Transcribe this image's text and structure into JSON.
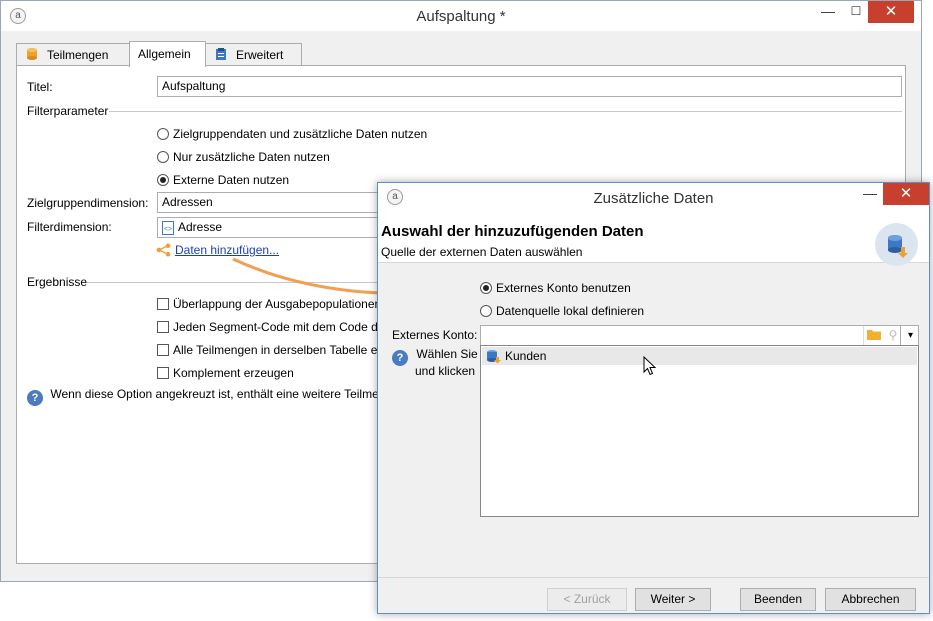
{
  "main_window": {
    "title": "Aufspaltung *",
    "controls": {
      "minimize": "—",
      "maximize": "☐",
      "close": "✕"
    },
    "tabs": [
      {
        "label": "Teilmengen",
        "icon": "database-icon"
      },
      {
        "label": "Allgemein",
        "icon": "none"
      },
      {
        "label": "Erweitert",
        "icon": "clipboard-icon"
      }
    ],
    "active_tab": "Allgemein",
    "titel_label": "Titel:",
    "titel_value": "Aufspaltung",
    "filterparameter_label": "Filterparameter",
    "radio_options": [
      {
        "label": "Zielgruppendaten und zusätzliche Daten nutzen",
        "selected": false
      },
      {
        "label": "Nur zusätzliche Daten nutzen",
        "selected": false
      },
      {
        "label": "Externe Daten nutzen",
        "selected": true
      }
    ],
    "zielgruppendimension_label": "Zielgruppendimension:",
    "zielgruppendimension_value": "Adressen",
    "filterdimension_label": "Filterdimension:",
    "filterdimension_value": "Adresse",
    "add_data_link": "Daten hinzufügen...",
    "ergebnisse_label": "Ergebnisse",
    "checkboxes": [
      {
        "label": "Überlappung der Ausgabepopulationen",
        "checked": false
      },
      {
        "label": "Jeden Segment-Code mit dem Code de",
        "checked": false
      },
      {
        "label": "Alle Teilmengen in derselben Tabelle e",
        "checked": false
      },
      {
        "label": "Komplement erzeugen",
        "checked": false
      }
    ],
    "help_text": "Wenn diese Option angekreuzt ist, enthält eine weitere Teilmen"
  },
  "dialog": {
    "title": "Zusätzliche Daten",
    "controls": {
      "minimize": "—",
      "close": "✕"
    },
    "header_title": "Auswahl der hinzuzufügenden Daten",
    "header_subtitle": "Quelle der externen Daten auswählen",
    "radio_options": [
      {
        "label": "Externes Konto benutzen",
        "selected": true
      },
      {
        "label": "Datenquelle lokal definieren",
        "selected": false
      }
    ],
    "externes_konto_label": "Externes Konto:",
    "externes_konto_value": "",
    "help_text_line1": "Wählen Sie d",
    "help_text_line2": "und klicken",
    "list_items": [
      {
        "label": "Kunden",
        "icon": "database-icon"
      }
    ],
    "buttons": {
      "back": "< Zurück",
      "next": "Weiter >",
      "finish": "Beenden",
      "cancel": "Abbrechen"
    }
  },
  "colors": {
    "close_button": "#c7402e",
    "link": "#1a3fb0",
    "arrow": "#f0a050",
    "icon_blue": "#3c78c4",
    "icon_orange": "#f0a030"
  }
}
